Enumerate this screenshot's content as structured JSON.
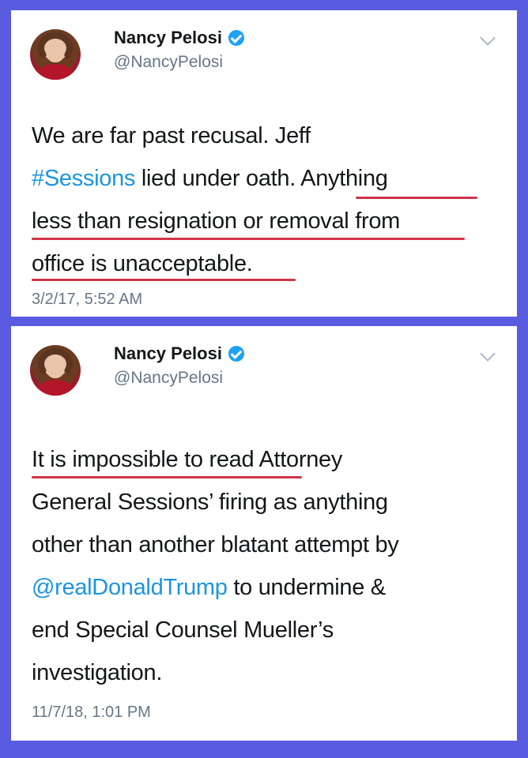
{
  "tweets": [
    {
      "author_name": "Nancy Pelosi",
      "handle": "@NancyPelosi",
      "lines": [
        {
          "parts": [
            {
              "text": "We are far past recusal. Jeff",
              "link": false
            }
          ]
        },
        {
          "parts": [
            {
              "text": "#Sessions",
              "link": true
            },
            {
              "text": " lied under oath. Anything",
              "link": false
            }
          ]
        },
        {
          "parts": [
            {
              "text": "less than resignation or removal from",
              "link": false
            }
          ]
        },
        {
          "parts": [
            {
              "text": "office is unacceptable.",
              "link": false
            }
          ]
        }
      ],
      "timestamp": "3/2/17, 5:52 AM"
    },
    {
      "author_name": "Nancy Pelosi",
      "handle": "@NancyPelosi",
      "lines": [
        {
          "parts": [
            {
              "text": "It is impossible to read Attorney",
              "link": false
            }
          ]
        },
        {
          "parts": [
            {
              "text": "General Sessions’ firing as anything",
              "link": false
            }
          ]
        },
        {
          "parts": [
            {
              "text": "other than another blatant attempt by",
              "link": false
            }
          ]
        },
        {
          "parts": [
            {
              "text": "@realDonaldTrump",
              "link": true
            },
            {
              "text": " to undermine &",
              "link": false
            }
          ]
        },
        {
          "parts": [
            {
              "text": "end Special Counsel Mueller’s",
              "link": false
            }
          ]
        },
        {
          "parts": [
            {
              "text": "investigation.",
              "link": false
            }
          ]
        }
      ],
      "timestamp": "11/7/18, 1:01 PM"
    }
  ],
  "colors": {
    "frame": "#5a5ce0",
    "link": "#1b95e0",
    "verified": "#1da1f2",
    "underline": "#d0344a"
  },
  "icons": [
    "verified-badge-icon",
    "chevron-down-icon"
  ]
}
